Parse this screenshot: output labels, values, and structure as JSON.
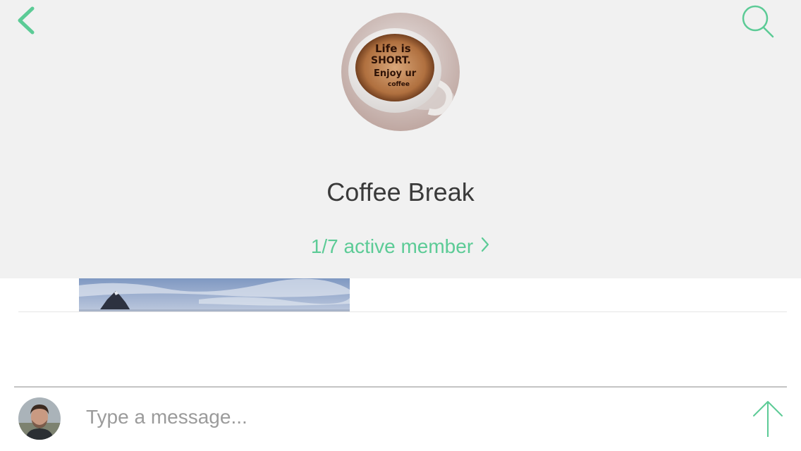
{
  "header": {
    "back_icon": "chevron-left-icon",
    "search_icon": "search-icon",
    "group_avatar_caption": [
      "Life is",
      "SHORT.",
      "Enjoy ur",
      "coffee"
    ],
    "title": "Coffee Break",
    "members_label": "1/7 active member",
    "members_chevron_icon": "chevron-right-icon"
  },
  "composer": {
    "placeholder": "Type a message...",
    "send_icon": "arrow-up-icon"
  },
  "colors": {
    "accent": "#5ccb96",
    "header_bg": "#f1f1f1",
    "title_text": "#3a3a3a"
  }
}
